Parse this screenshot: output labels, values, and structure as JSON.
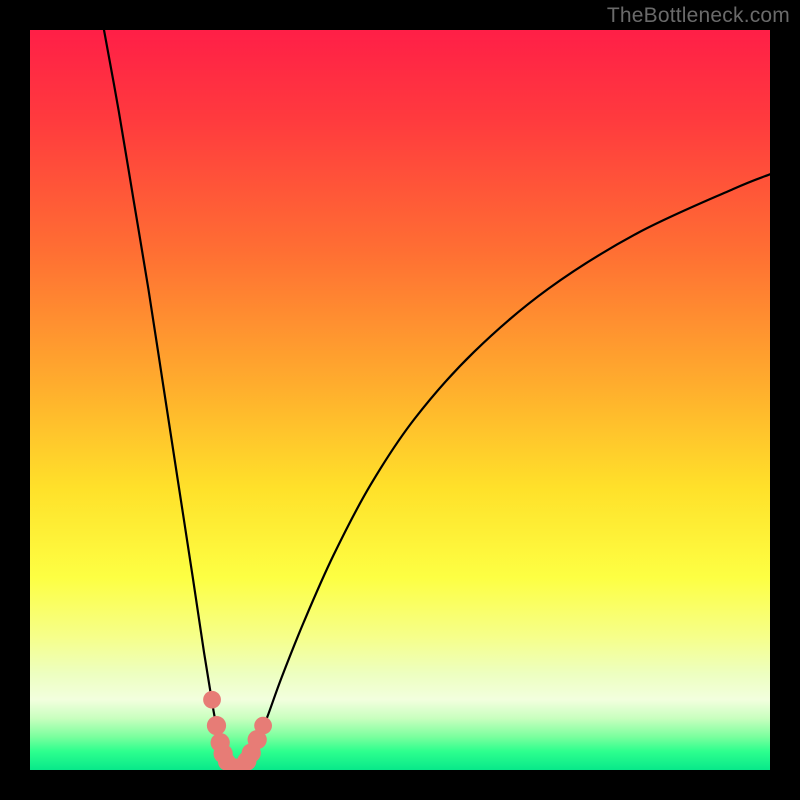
{
  "watermark": "TheBottleneck.com",
  "chart_data": {
    "type": "line",
    "title": "",
    "xlabel": "",
    "ylabel": "",
    "xlim": [
      0,
      100
    ],
    "ylim": [
      0,
      100
    ],
    "grid": false,
    "legend": false,
    "gradient_stops": [
      {
        "pos": 0.0,
        "color": "#ff1f47"
      },
      {
        "pos": 0.12,
        "color": "#ff3a3e"
      },
      {
        "pos": 0.3,
        "color": "#ff6f33"
      },
      {
        "pos": 0.48,
        "color": "#ffad2d"
      },
      {
        "pos": 0.62,
        "color": "#ffe12a"
      },
      {
        "pos": 0.74,
        "color": "#fdff43"
      },
      {
        "pos": 0.82,
        "color": "#f6ff8a"
      },
      {
        "pos": 0.87,
        "color": "#edffc0"
      },
      {
        "pos": 0.905,
        "color": "#f2ffde"
      },
      {
        "pos": 0.93,
        "color": "#c9ffbf"
      },
      {
        "pos": 0.955,
        "color": "#7bff9e"
      },
      {
        "pos": 0.975,
        "color": "#2dff8e"
      },
      {
        "pos": 1.0,
        "color": "#08e88a"
      }
    ],
    "series": [
      {
        "name": "left-branch",
        "x": [
          10.0,
          12.0,
          14.0,
          16.0,
          18.0,
          20.0,
          22.0,
          23.5,
          24.8,
          25.6,
          26.2,
          26.7,
          27.1
        ],
        "y": [
          100.0,
          89.0,
          77.0,
          65.0,
          52.0,
          39.0,
          26.0,
          16.0,
          8.0,
          4.0,
          2.0,
          1.0,
          0.5
        ]
      },
      {
        "name": "right-branch",
        "x": [
          28.8,
          29.5,
          30.5,
          32.0,
          34.0,
          37.0,
          41.0,
          46.0,
          52.0,
          60.0,
          70.0,
          82.0,
          95.0,
          100.0
        ],
        "y": [
          0.5,
          1.5,
          3.5,
          7.0,
          12.5,
          20.0,
          29.0,
          38.5,
          47.5,
          56.5,
          65.0,
          72.5,
          78.5,
          80.5
        ]
      }
    ],
    "valley": {
      "range_x": [
        27.1,
        28.8
      ],
      "y": 0.3
    },
    "markers": [
      {
        "x": 24.6,
        "y": 9.5,
        "r": 1.2
      },
      {
        "x": 25.2,
        "y": 6.0,
        "r": 1.3
      },
      {
        "x": 25.7,
        "y": 3.7,
        "r": 1.3
      },
      {
        "x": 26.1,
        "y": 2.2,
        "r": 1.3
      },
      {
        "x": 26.6,
        "y": 1.1,
        "r": 1.2
      },
      {
        "x": 27.2,
        "y": 0.6,
        "r": 1.1
      },
      {
        "x": 27.9,
        "y": 0.45,
        "r": 1.1
      },
      {
        "x": 28.6,
        "y": 0.55,
        "r": 1.1
      },
      {
        "x": 29.3,
        "y": 1.2,
        "r": 1.3
      },
      {
        "x": 29.9,
        "y": 2.3,
        "r": 1.3
      },
      {
        "x": 30.7,
        "y": 4.1,
        "r": 1.3
      },
      {
        "x": 31.5,
        "y": 6.0,
        "r": 1.2
      }
    ]
  }
}
